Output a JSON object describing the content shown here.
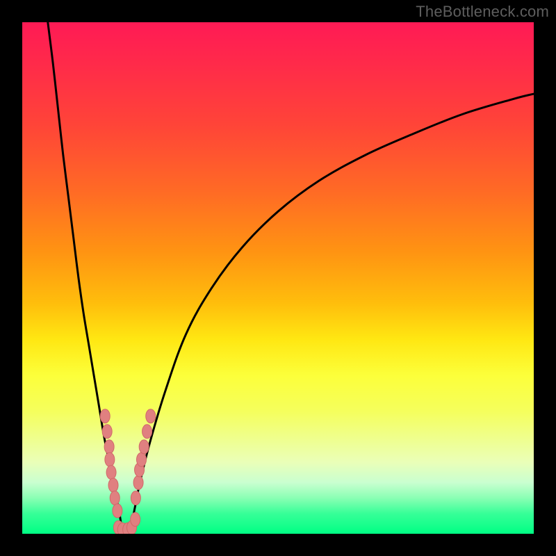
{
  "watermark": "TheBottleneck.com",
  "colors": {
    "frame": "#000000",
    "curve": "#000000",
    "marker_fill": "#e08080",
    "marker_stroke": "#d16868"
  },
  "chart_data": {
    "type": "line",
    "title": "",
    "xlabel": "",
    "ylabel": "",
    "xlim": [
      0,
      100
    ],
    "ylim": [
      0,
      100
    ],
    "grid": false,
    "legend": false,
    "series": [
      {
        "name": "left-branch",
        "x": [
          5,
          6,
          7,
          8,
          9,
          10,
          11,
          12,
          13,
          14,
          15,
          16,
          17,
          18,
          19,
          19.6
        ],
        "values": [
          100,
          92,
          83,
          74,
          66,
          58,
          50,
          43,
          37,
          31,
          25,
          19,
          14,
          9,
          4,
          0
        ]
      },
      {
        "name": "right-branch",
        "x": [
          21,
          22,
          23,
          25,
          28,
          32,
          37,
          43,
          50,
          58,
          67,
          76,
          86,
          96,
          100
        ],
        "values": [
          0,
          5,
          10,
          18,
          28,
          39,
          48,
          56,
          63,
          69,
          74,
          78,
          82,
          85,
          86
        ]
      }
    ],
    "markers": [
      {
        "name": "left-cluster",
        "points": [
          [
            16.2,
            23
          ],
          [
            16.6,
            20
          ],
          [
            17.0,
            17
          ],
          [
            17.1,
            14.5
          ],
          [
            17.4,
            12
          ],
          [
            17.8,
            9.5
          ],
          [
            18.1,
            7
          ],
          [
            18.6,
            4.5
          ]
        ]
      },
      {
        "name": "right-cluster",
        "points": [
          [
            22.2,
            7
          ],
          [
            22.7,
            10
          ],
          [
            22.9,
            12.5
          ],
          [
            23.3,
            14.5
          ],
          [
            23.8,
            17
          ],
          [
            24.4,
            20
          ],
          [
            25.1,
            23
          ]
        ]
      },
      {
        "name": "valley-floor",
        "points": [
          [
            18.8,
            1.2
          ],
          [
            19.6,
            0.8
          ],
          [
            20.6,
            0.8
          ],
          [
            21.4,
            1.2
          ],
          [
            22.1,
            2.8
          ]
        ]
      }
    ]
  }
}
